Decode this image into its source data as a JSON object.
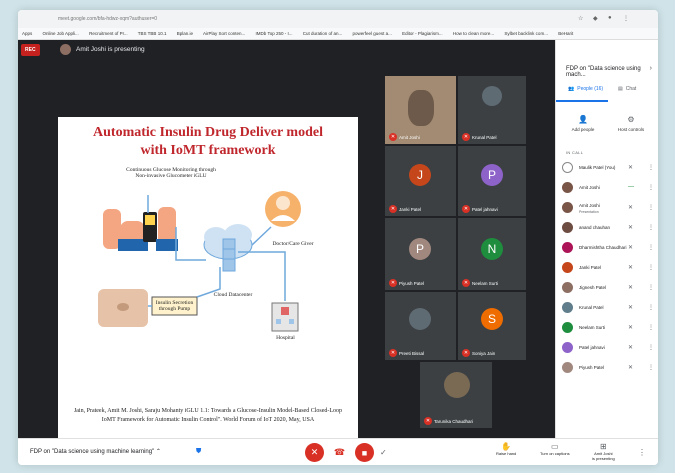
{
  "browser": {
    "url": "meet.google.com/bfa-hdwz-xqm?authuser=0",
    "bookmarks": [
      "Apps",
      "Online Job Appli...",
      "Recruitment of Pr...",
      "TBS TBB 10.1",
      "Bplan.ie",
      "AirPlay Sort conten...",
      "IMDb Top 250 - I...",
      "Cut duration of an...",
      "powerfeel guest a...",
      "Editor - Plagiarism...",
      "How to clean more...",
      "Sylbet backlink com...",
      "BeHarit"
    ]
  },
  "meet": {
    "rec_label": "REC",
    "presenter_text": "Amit Joshi is presenting"
  },
  "slide": {
    "title_line1": "Automatic Insulin Drug Deliver model",
    "title_line2": "with IoMT framework",
    "cgm_label_line1": "Continuous Glucose Monitoring through",
    "cgm_label_line2": "Non-invasive Glucometer iGLU",
    "doctor_label": "Doctor/Care Giver",
    "cloud_label": "Cloud Datacenter",
    "pump_label_line1": "Insulin Secretion",
    "pump_label_line2": "through Pump",
    "hospital_label": "Hospital",
    "reference": "Jain, Prateek, Amit M. Joshi, Saraju Mohanty iGLU 1.1: Towards a Glucose-Insulin Model-Based Closed-Loop IoMT Framework for Automatic Insulin Control\". World Forum of IoT 2020, May, USA"
  },
  "tiles": [
    {
      "name": "Amit Joshi",
      "initial": "",
      "color": "#6d5a4a"
    },
    {
      "name": "Krunal Patel",
      "initial": "",
      "color": "#5f6b73"
    },
    {
      "name": "Janki Patel",
      "initial": "J",
      "color": "#c5461b"
    },
    {
      "name": "Patel jahnavi",
      "initial": "P",
      "color": "#8e63c9"
    },
    {
      "name": "Piyush Patel",
      "initial": "P",
      "color": "#a1887f"
    },
    {
      "name": "Neelam Surti",
      "initial": "N",
      "color": "#1e8e3e"
    },
    {
      "name": "Preeti Bissal",
      "initial": "",
      "color": "#5f6b73"
    },
    {
      "name": "Soniya Jain",
      "initial": "S",
      "color": "#ef6c00"
    },
    {
      "name": "Tarunika Chaudhari",
      "initial": "",
      "color": "#7a6a54"
    }
  ],
  "sidebar": {
    "title": "FDP on \"Data science using mach...",
    "tab_people": "People (16)",
    "tab_chat": "Chat",
    "add_people": "Add people",
    "host_controls": "Host controls",
    "section": "IN CALL",
    "people": [
      {
        "name": "Maulik Patel (You)",
        "sub": "",
        "color": "#ffffff"
      },
      {
        "name": "Amit Joshi",
        "sub": "",
        "color": "#795548"
      },
      {
        "name": "Amit Joshi",
        "sub": "Presentation",
        "color": "#795548"
      },
      {
        "name": "anand chauhan",
        "sub": "",
        "color": "#6d4c41"
      },
      {
        "name": "Dharmishtha Chaudhari",
        "sub": "",
        "color": "#ad1457"
      },
      {
        "name": "Janki Patel",
        "sub": "",
        "color": "#c5461b"
      },
      {
        "name": "Jignesh Patel",
        "sub": "",
        "color": "#8d6e63"
      },
      {
        "name": "Krunal Patel",
        "sub": "",
        "color": "#607d8b"
      },
      {
        "name": "Neelam Surti",
        "sub": "",
        "color": "#1e8e3e"
      },
      {
        "name": "Patel jahnavi",
        "sub": "",
        "color": "#8e63c9"
      },
      {
        "name": "Piyush Patel",
        "sub": "",
        "color": "#a1887f"
      }
    ]
  },
  "bottom": {
    "meeting_title": "FDP on \"Data science using machine learning\"",
    "raise_hand": "Raise hand",
    "captions": "Turn on captions",
    "presenting_name": "Amit Joshi",
    "presenting_sub": "is presenting"
  }
}
